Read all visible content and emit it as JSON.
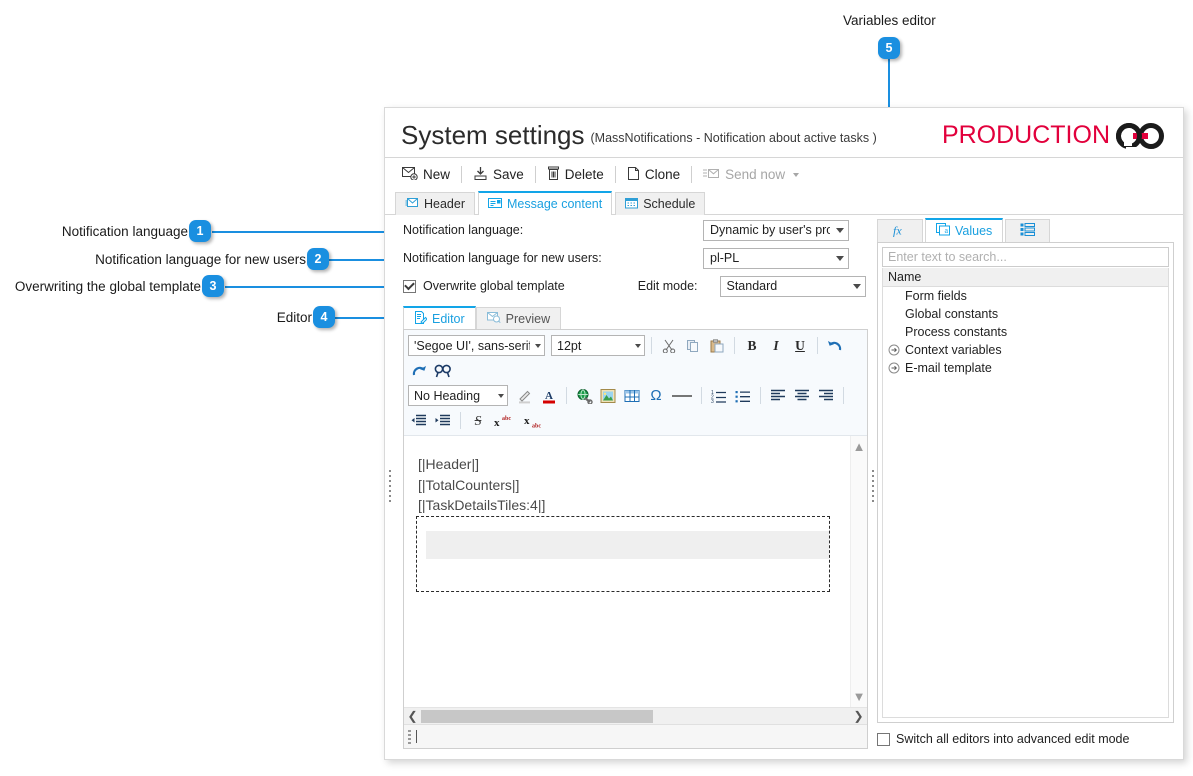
{
  "callouts": [
    {
      "n": "1",
      "label": "Notification language"
    },
    {
      "n": "2",
      "label": "Notification language for new users"
    },
    {
      "n": "3",
      "label": "Overwriting the global template"
    },
    {
      "n": "4",
      "label": "Editor"
    },
    {
      "n": "5",
      "label": "Variables editor"
    }
  ],
  "window": {
    "title": "System settings",
    "subtitle": "(MassNotifications - Notification about active tasks )",
    "environment": "PRODUCTION"
  },
  "commands": [
    {
      "label": "New",
      "icon": "new-mail-icon",
      "disabled": false
    },
    {
      "label": "Save",
      "icon": "save-icon",
      "disabled": false
    },
    {
      "label": "Delete",
      "icon": "trash-icon",
      "disabled": false
    },
    {
      "label": "Clone",
      "icon": "copy-page-icon",
      "disabled": false
    },
    {
      "label": "Send now",
      "icon": "send-mail-icon",
      "disabled": true,
      "dropdown": true
    }
  ],
  "main_tabs": [
    {
      "label": "Header",
      "icon": "envelope-header-icon",
      "active": false
    },
    {
      "label": "Message content",
      "icon": "message-card-icon",
      "active": true
    },
    {
      "label": "Schedule",
      "icon": "calendar-icon",
      "active": false
    }
  ],
  "form": {
    "notification_language_label": "Notification language:",
    "notification_language_value": "Dynamic by user's prof...",
    "new_users_language_label": "Notification language for new users:",
    "new_users_language_value": "pl-PL",
    "overwrite_label": "Overwrite global template",
    "overwrite_checked": true,
    "edit_mode_label": "Edit mode:",
    "edit_mode_value": "Standard"
  },
  "editor_tabs": [
    {
      "label": "Editor",
      "icon": "edit-document-icon",
      "active": true
    },
    {
      "label": "Preview",
      "icon": "preview-mail-icon",
      "active": false
    }
  ],
  "rich_toolbar": {
    "font_family": "'Segoe UI', sans-serif",
    "font_size": "12pt",
    "heading": "No Heading",
    "row1_icons": [
      "cut-icon",
      "copy-icon",
      "paste-icon",
      "bold-icon",
      "italic-icon",
      "underline-icon",
      "undo-icon"
    ],
    "row2_icons": [
      "redo-icon",
      "find-replace-icon"
    ],
    "row3_icons": [
      "highlight-icon",
      "font-color-icon",
      "insert-link-icon",
      "insert-image-icon",
      "insert-table-icon",
      "special-character-icon",
      "horizontal-rule-icon",
      "numbered-list-icon",
      "bulleted-list-icon",
      "align-left-icon",
      "align-center-icon",
      "align-right-icon"
    ],
    "row4_icons": [
      "decrease-indent-icon",
      "increase-indent-icon",
      "strikethrough-icon",
      "superscript-icon",
      "subscript-icon"
    ]
  },
  "editor_content": {
    "lines": [
      "[|Header|]",
      "[|TotalCounters|]",
      "[|TaskDetailsTiles:4|]"
    ]
  },
  "variables_panel": {
    "tabs": [
      {
        "label": "",
        "icon": "function-fx-icon",
        "active": false
      },
      {
        "label": "Values",
        "icon": "values-card-icon",
        "active": true
      },
      {
        "label": "",
        "icon": "list-properties-icon",
        "active": false
      }
    ],
    "search_placeholder": "Enter text to search...",
    "column_header": "Name",
    "rows": [
      {
        "label": "Form fields",
        "expandable": false
      },
      {
        "label": "Global constants",
        "expandable": false
      },
      {
        "label": "Process constants",
        "expandable": false
      },
      {
        "label": "Context variables",
        "expandable": true
      },
      {
        "label": "E-mail template",
        "expandable": true
      }
    ],
    "bottom_checkbox_label": "Switch all editors into advanced edit mode",
    "bottom_checkbox_checked": false
  },
  "colors": {
    "accent": "#12a5e8",
    "badge": "#1a8fe0",
    "env": "#e2003c"
  }
}
